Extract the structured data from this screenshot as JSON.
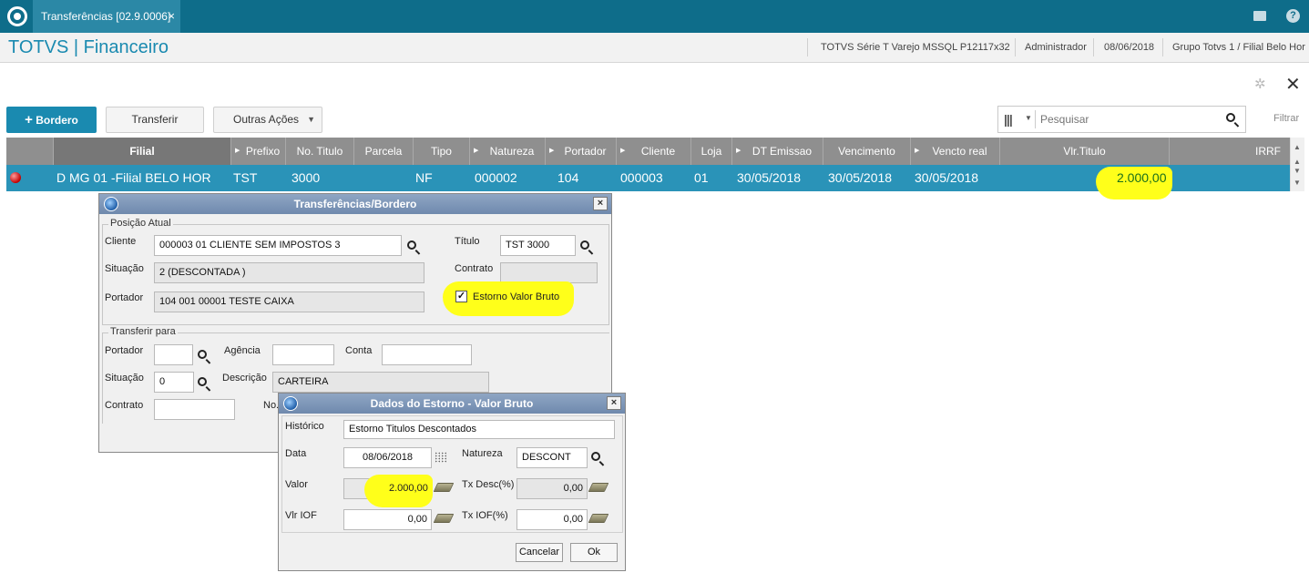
{
  "topbar": {
    "tab_label": "Transferências [02.9.0006]",
    "tab_close": "×",
    "help": "?"
  },
  "header": {
    "title": "TOTVS | Financeiro",
    "system": "TOTVS Série T Varejo MSSQL P12117x32",
    "user": "Administrador",
    "date": "08/06/2018",
    "company": "Grupo Totvs 1 / Filial Belo Hor"
  },
  "toolbar": {
    "bordero": "Bordero",
    "transferir": "Transferir",
    "outras_acoes": "Outras Ações",
    "search_placeholder": "Pesquisar",
    "filtrar": "Filtrar"
  },
  "grid": {
    "columns": [
      "Filial",
      "Prefixo",
      "No. Titulo",
      "Parcela",
      "Tipo",
      "Natureza",
      "Portador",
      "Cliente",
      "Loja",
      "DT Emissao",
      "Vencimento",
      "Vencto real",
      "Vlr.Titulo",
      "IRRF"
    ],
    "row": {
      "filial": "D MG 01 -Filial BELO HOR",
      "prefixo": "TST",
      "no_titulo": "3000",
      "parcela": "",
      "tipo": "NF",
      "natureza": "000002",
      "portador": "104",
      "cliente": "000003",
      "loja": "01",
      "dt_emissao": "30/05/2018",
      "vencimento": "30/05/2018",
      "vencto_real": "30/05/2018",
      "vlr_titulo": "2.000,00"
    }
  },
  "dialog1": {
    "title": "Transferências/Bordero",
    "close": "×",
    "posicao_atual": "Posição Atual",
    "cliente_label": "Cliente",
    "cliente_value": "000003 01 CLIENTE SEM IMPOSTOS 3",
    "titulo_label": "Título",
    "titulo_value": "TST 3000",
    "situacao_label": "Situação",
    "situacao_value": "2 (DESCONTADA                         )",
    "contrato_label": "Contrato",
    "portador_label": "Portador",
    "portador_value": "104 001   00001     TESTE CAIXA",
    "estorno_label": "Estorno Valor Bruto",
    "transferir_para": "Transferir para",
    "t_portador_label": "Portador",
    "agencia_label": "Agência",
    "conta_label": "Conta",
    "t_situacao_label": "Situação",
    "t_situacao_value": "0",
    "descricao_label": "Descrição",
    "descricao_value": "CARTEIRA",
    "t_contrato_label": "Contrato",
    "no_label": "No."
  },
  "dialog2": {
    "title": "Dados do Estorno - Valor Bruto",
    "close": "×",
    "historico_label": "Histórico",
    "historico_value": "Estorno Titulos Descontados",
    "data_label": "Data",
    "data_value": "08/06/2018",
    "natureza_label": "Natureza",
    "natureza_value": "DESCONT",
    "valor_label": "Valor",
    "valor_value": "2.000,00",
    "txdesc_label": "Tx Desc(%)",
    "txdesc_value": "0,00",
    "vliof_label": "Vlr IOF",
    "vliof_value": "0,00",
    "txiof_label": "Tx IOF(%)",
    "txiof_value": "0,00",
    "cancelar": "Cancelar",
    "ok": "Ok"
  },
  "colors": {
    "accent": "#1a8ab0",
    "topbar": "#0e6d8a",
    "selected_row": "#2a93b8",
    "highlight": "#ffff1a"
  }
}
